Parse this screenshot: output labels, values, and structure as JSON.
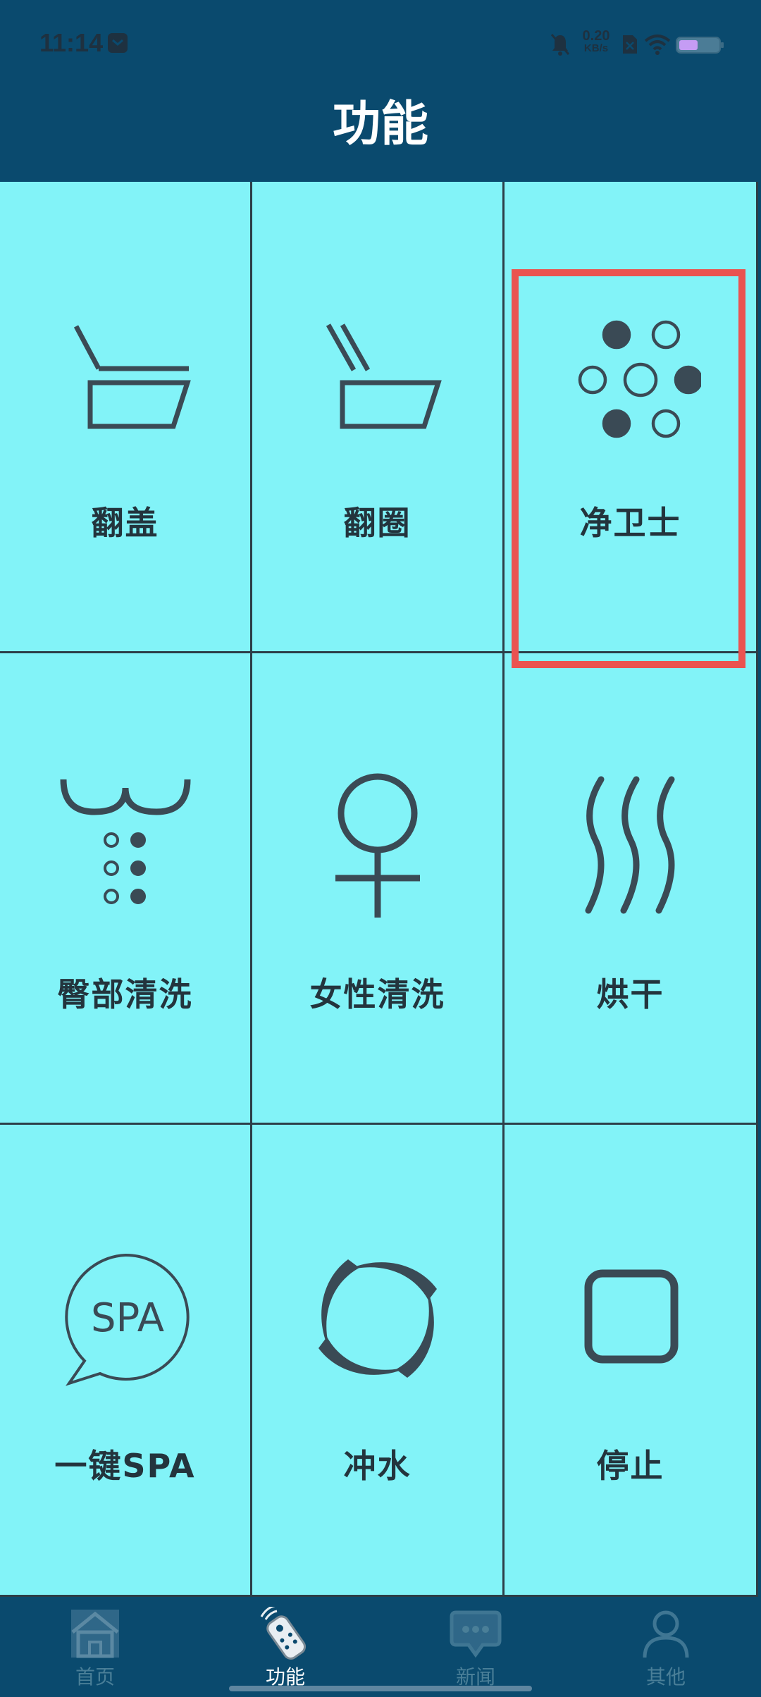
{
  "status_bar": {
    "time": "11:14",
    "net_speed_value": "0.20",
    "net_speed_unit": "KB/s"
  },
  "header": {
    "title": "功能"
  },
  "grid": {
    "items": [
      {
        "label": "翻盖",
        "icon": "lid-flip-icon"
      },
      {
        "label": "翻圈",
        "icon": "seat-ring-flip-icon"
      },
      {
        "label": "净卫士",
        "icon": "sanitize-dots-icon"
      },
      {
        "label": "臀部清洗",
        "icon": "rear-wash-icon"
      },
      {
        "label": "女性清洗",
        "icon": "female-wash-icon"
      },
      {
        "label": "烘干",
        "icon": "dry-heat-icon"
      },
      {
        "label": "一键SPA",
        "icon": "spa-bubble-icon",
        "icon_text": "SPA"
      },
      {
        "label": "冲水",
        "icon": "flush-swirl-icon"
      },
      {
        "label": "停止",
        "icon": "stop-square-icon"
      }
    ],
    "selected_index": 2
  },
  "bottom_nav": {
    "items": [
      {
        "label": "首页",
        "icon": "home-icon",
        "active": false
      },
      {
        "label": "功能",
        "icon": "remote-control-icon",
        "active": true
      },
      {
        "label": "新闻",
        "icon": "news-chat-icon",
        "active": false
      },
      {
        "label": "其他",
        "icon": "user-icon",
        "active": false
      }
    ]
  },
  "colors": {
    "header_bg": "#0a4a6e",
    "cell_bg": "#82f3f8",
    "icon_dark": "#3a4a55",
    "highlight": "#ea5350"
  }
}
